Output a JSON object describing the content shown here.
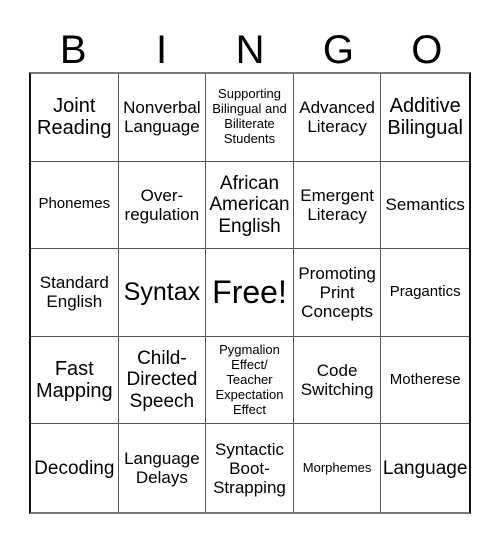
{
  "header": {
    "letters": [
      "B",
      "I",
      "N",
      "G",
      "O"
    ]
  },
  "card": {
    "cells": [
      "Joint Reading",
      "Nonverbal Language",
      "Supporting Bilingual and Biliterate Students",
      "Advanced Literacy",
      "Additive Bilingual",
      "Phonemes",
      "Over-regulation",
      "African American English",
      "Emergent Literacy",
      "Semantics",
      "Standard English",
      "Syntax",
      "Free!",
      "Promoting Print Concepts",
      "Pragantics",
      "Fast Mapping",
      "Child-Directed Speech",
      "Pygmalion Effect/ Teacher Expectation Effect",
      "Code Switching",
      "Motherese",
      "Decoding",
      "Language Delays",
      "Syntactic Boot-Strapping",
      "Morphemes",
      "Language"
    ],
    "free_space": "Free!"
  }
}
